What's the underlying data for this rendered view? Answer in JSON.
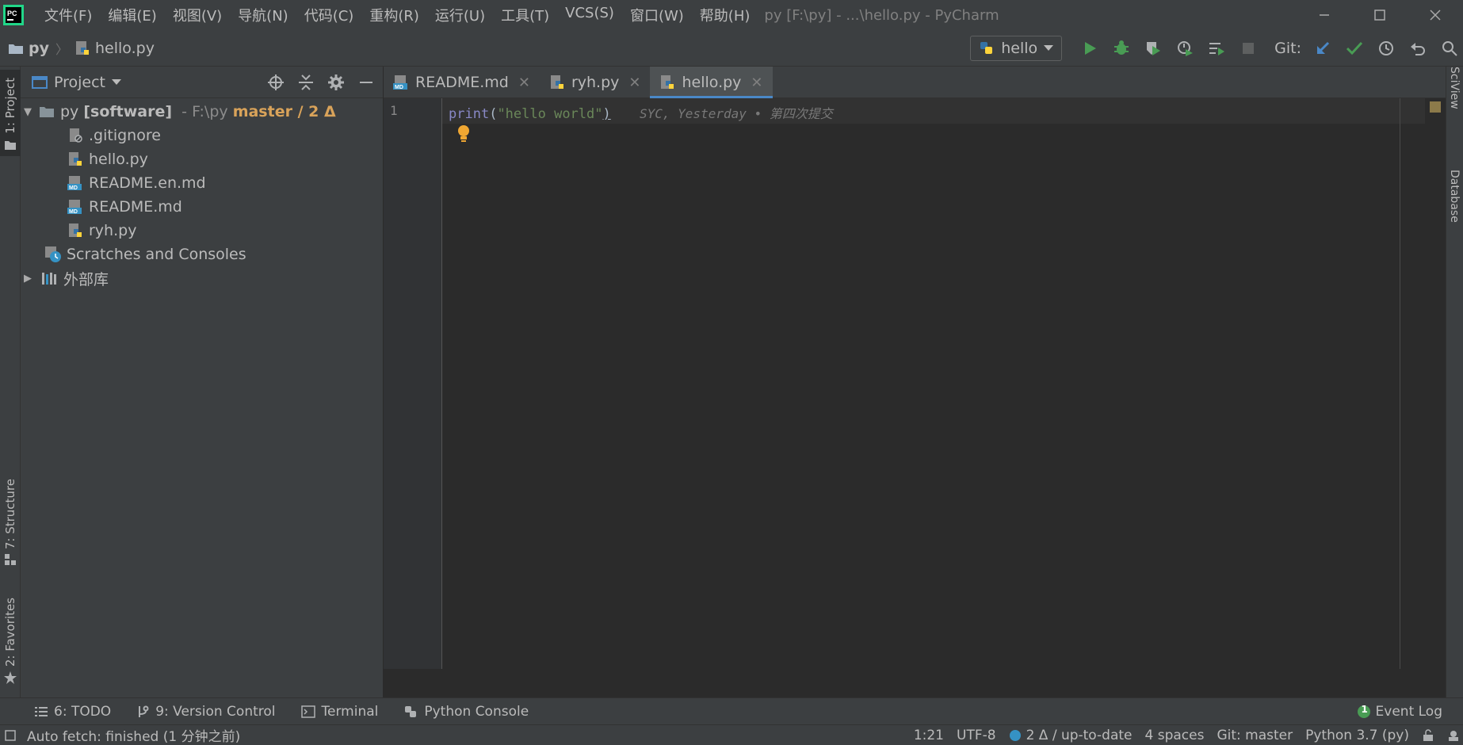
{
  "menubar": {
    "items": [
      "文件(F)",
      "编辑(E)",
      "视图(V)",
      "导航(N)",
      "代码(C)",
      "重构(R)",
      "运行(U)",
      "工具(T)",
      "VCS(S)",
      "窗口(W)",
      "帮助(H)"
    ],
    "window_title": "py [F:\\py] - ...\\hello.py - PyCharm"
  },
  "navbar": {
    "root": "py",
    "file": "hello.py",
    "run_config": "hello",
    "git_label": "Git:"
  },
  "left_strip": {
    "project": "1: Project",
    "structure": "7: Structure",
    "favorites": "2: Favorites"
  },
  "project_panel": {
    "title": "Project",
    "root": {
      "name": "py",
      "module": "[software]",
      "path": "- F:\\py",
      "branch": "master / 2 Δ"
    },
    "files": [
      ".gitignore",
      "hello.py",
      "README.en.md",
      "README.md",
      "ryh.py"
    ],
    "scratches": "Scratches and Consoles",
    "external_libs": "外部库"
  },
  "editor": {
    "tabs": [
      "README.md",
      "ryh.py",
      "hello.py"
    ],
    "active_tab": "hello.py",
    "line_number": "1",
    "code": {
      "fn": "print",
      "open": "(",
      "str": "\"hello world\"",
      "close": ")"
    },
    "blame": "SYC, Yesterday • 第四次提交"
  },
  "right_strip": {
    "sciview": "SciView",
    "database": "Database"
  },
  "bottom_tabs": {
    "todo": "6: TODO",
    "vcs": "9: Version Control",
    "terminal": "Terminal",
    "python_console": "Python Console",
    "event_log_count": "1",
    "event_log": "Event Log"
  },
  "status_bar": {
    "message": "Auto fetch: finished (1 分钟之前)",
    "position": "1:21",
    "encoding": "UTF-8",
    "vcs_status": "2 Δ / up-to-date",
    "indent": "4 spaces",
    "branch": "Git: master",
    "interpreter": "Python 3.7 (py)"
  },
  "colors": {
    "background": "#2b2b2b",
    "panel": "#3c3f41",
    "accent": "#4a88c7",
    "run_green": "#499c54",
    "branch_orange": "#d9a35a"
  }
}
